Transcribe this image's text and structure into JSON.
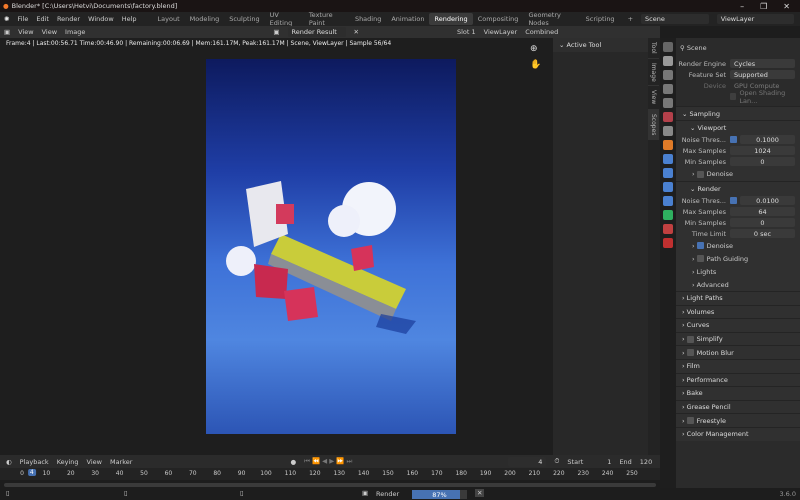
{
  "title": "Blender* [C:\\Users\\Hetvi\\Documents\\factory.blend]",
  "menu": [
    "File",
    "Edit",
    "Render",
    "Window",
    "Help"
  ],
  "workspaces": [
    "Layout",
    "Modeling",
    "Sculpting",
    "UV Editing",
    "Texture Paint",
    "Shading",
    "Animation",
    "Rendering",
    "Compositing",
    "Geometry Nodes",
    "Scripting"
  ],
  "active_workspace": "Rendering",
  "scene": "Scene",
  "view_layer": "ViewLayer",
  "image_header": {
    "view": "View",
    "view2": "View",
    "image": "Image",
    "image_name": "Render Result",
    "slot": "Slot 1",
    "layer": "ViewLayer",
    "pass": "Combined"
  },
  "info": "Frame:4 | Last:00:56.71 Time:00:46.90 | Remaining:00:06.69 | Mem:161.17M, Peak:161.17M | Scene, ViewLayer | Sample 56/64",
  "npanel": {
    "header": "Active Tool",
    "tabs": [
      "Tool",
      "Image",
      "View",
      "Scopes"
    ]
  },
  "props": {
    "scene_label": "Scene",
    "render_engine": {
      "label": "Render Engine",
      "value": "Cycles"
    },
    "feature_set": {
      "label": "Feature Set",
      "value": "Supported"
    },
    "device": {
      "label": "Device",
      "value": "GPU Compute"
    },
    "osl": "Open Shading Lan...",
    "sampling": "Sampling",
    "viewport": {
      "title": "Viewport",
      "noise_label": "Noise Thres...",
      "noise": "0.1000",
      "max_label": "Max Samples",
      "max": "1024",
      "min_label": "Min Samples",
      "min": "0",
      "denoise": "Denoise"
    },
    "render": {
      "title": "Render",
      "noise_label": "Noise Thres...",
      "noise": "0.0100",
      "max_label": "Max Samples",
      "max": "64",
      "min_label": "Min Samples",
      "min": "0",
      "time_label": "Time Limit",
      "time": "0 sec",
      "denoise": "Denoise",
      "path_guiding": "Path Guiding",
      "lights": "Lights",
      "advanced": "Advanced"
    },
    "panels": [
      "Light Paths",
      "Volumes",
      "Curves",
      "Simplify",
      "Motion Blur",
      "Film",
      "Performance",
      "Bake",
      "Grease Pencil",
      "Freestyle",
      "Color Management"
    ]
  },
  "timeline": {
    "playback": "Playback",
    "keying": "Keying",
    "view": "View",
    "marker": "Marker",
    "current": "4",
    "start_label": "Start",
    "start": "1",
    "end_label": "End",
    "end": "120",
    "ticks": [
      "0",
      "10",
      "20",
      "30",
      "40",
      "50",
      "60",
      "70",
      "80",
      "90",
      "100",
      "110",
      "120",
      "130",
      "140",
      "150",
      "160",
      "170",
      "180",
      "190",
      "200",
      "210",
      "220",
      "230",
      "240",
      "250"
    ]
  },
  "status": {
    "render_label": "Render",
    "progress_text": "87%",
    "progress": 0.87,
    "version": "3.6.0"
  }
}
